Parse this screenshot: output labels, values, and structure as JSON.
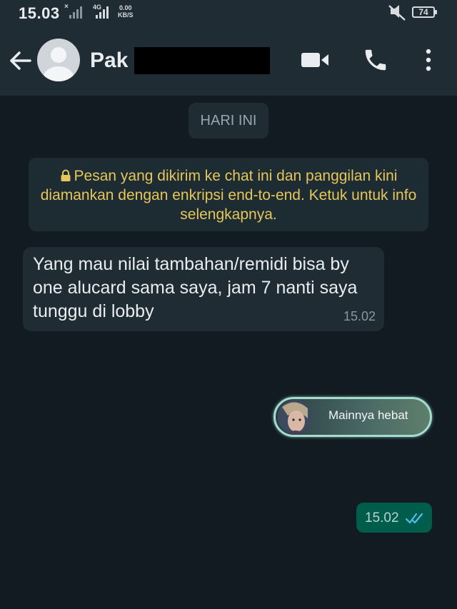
{
  "status_bar": {
    "time": "15.03",
    "signal_1_marker": "×",
    "signal_2_label": "4G",
    "net_speed_value": "0.00",
    "net_speed_unit": "KB/S",
    "battery_level": "74",
    "icons": [
      "signal-icon",
      "mute-icon",
      "battery-icon"
    ]
  },
  "header": {
    "contact_name": "Pak",
    "icons": [
      "back-arrow-icon",
      "avatar-icon",
      "video-call-icon",
      "phone-icon",
      "more-options-icon"
    ]
  },
  "chat": {
    "date_chip": "HARI INI",
    "encryption_notice": "Pesan yang dikirim ke chat ini dan panggilan kini diamankan dengan enkripsi end-to-end. Ketuk untuk info selengkapnya.",
    "messages": [
      {
        "direction": "incoming",
        "text": "Yang mau nilai tambahan/remidi bisa by one alucard sama saya, jam 7 nanti saya tunggu di lobby",
        "time": "15.02"
      },
      {
        "direction": "outgoing",
        "type": "sticker",
        "sticker_text": "Mainnya hebat",
        "time": "15.02",
        "status": "read",
        "status_icon": "double-check-icon"
      }
    ]
  },
  "colors": {
    "background": "#121b22",
    "header": "#1f2c34",
    "incoming_bubble": "#1f2c34",
    "outgoing_bubble": "#005c4b",
    "notice_text": "#e6c65a",
    "read_ticks": "#53bdeb"
  }
}
